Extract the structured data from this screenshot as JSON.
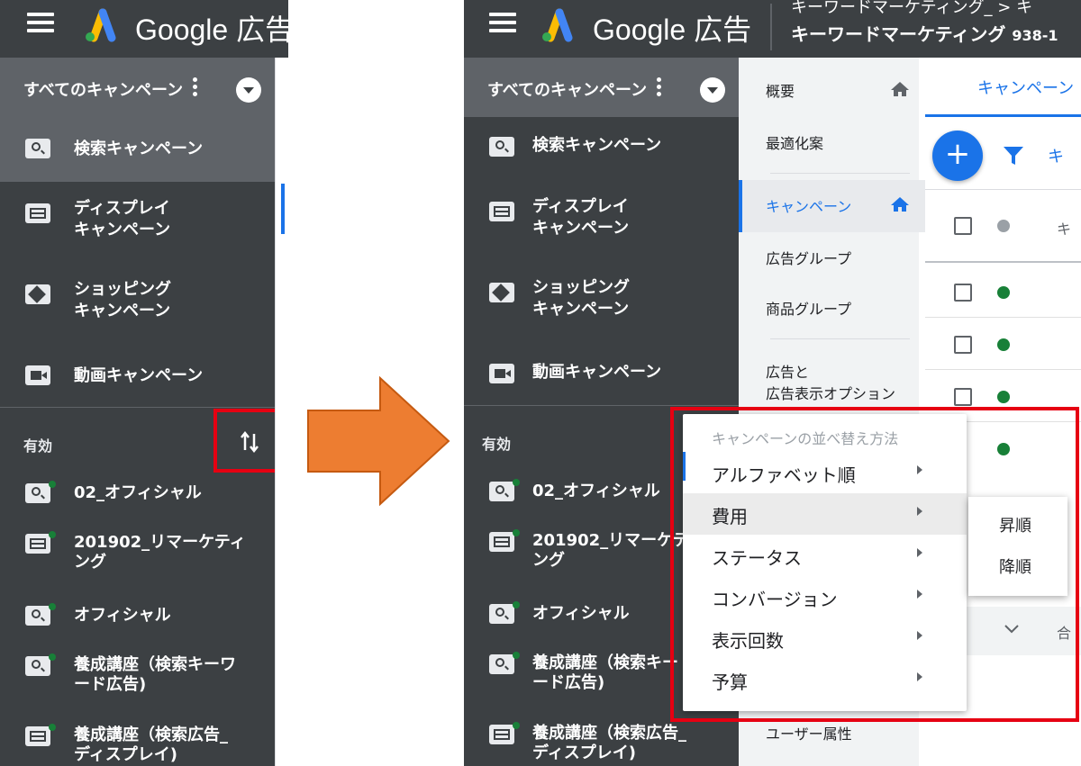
{
  "app": {
    "brand": "Google 広告"
  },
  "account": {
    "line1": "キーワードマーケティング_ > キ",
    "line2": "キーワードマーケティング",
    "id": "938-1"
  },
  "sidebar": {
    "campaign_selector": "すべてのキャンペーン",
    "types": [
      {
        "label": "検索キャンペーン",
        "icon": "search-icon"
      },
      {
        "label_l1": "ディスプレイ",
        "label_l2": "キャンペーン",
        "icon": "display-icon"
      },
      {
        "label_l1": "ショッピング",
        "label_l2": "キャンペーン",
        "icon": "shopping-tag-icon"
      },
      {
        "label": "動画キャンペーン",
        "icon": "video-icon"
      }
    ],
    "section_label": "有効",
    "campaigns": [
      {
        "label": "02_オフィシャル",
        "icon": "search-icon"
      },
      {
        "label_l1": "201902_リマーケティ",
        "label_l2": "ング",
        "icon": "display-icon"
      },
      {
        "label": "オフィシャル",
        "icon": "search-icon"
      },
      {
        "label_l1": "養成講座（検索キーワ",
        "label_l2": "ード広告)",
        "icon": "search-icon"
      },
      {
        "label_l1": "養成講座（検索広告_",
        "label_l2": "ディスプレイ)",
        "icon": "display-icon"
      }
    ],
    "campaigns_right": [
      {
        "label_l1": "201902_リマーケテ",
        "label_l2": "ング"
      },
      {
        "label_l1": "養成講座（検索キー",
        "label_l2": "ード広告)"
      },
      {
        "label_l1": "養成講座（検索広告_",
        "label_l2": "ディスプレイ)"
      }
    ]
  },
  "pagenav": {
    "items": [
      "概要",
      "最適化案",
      "キャンペーン",
      "広告グループ",
      "商品グループ",
      "広告と",
      "広告表示オプション",
      "ユーザー属性"
    ],
    "active": "キャンペーン"
  },
  "main": {
    "tab_label": "キャンペーン",
    "fab": "+",
    "filter_text": "キ",
    "header_col": "キ",
    "bottom_text": "合"
  },
  "sort_menu": {
    "header": "キャンペーンの並べ替え方法",
    "options": [
      "アルファベット順",
      "費用",
      "ステータス",
      "コンバージョン",
      "表示回数",
      "予算"
    ],
    "hovered": "費用",
    "submenu": [
      "昇順",
      "降順"
    ]
  },
  "colors": {
    "dark": "#3c4043",
    "accent": "#1a73e8",
    "highlight": "#e60012",
    "arrow": "#ed7d31",
    "status_green": "#188038"
  }
}
